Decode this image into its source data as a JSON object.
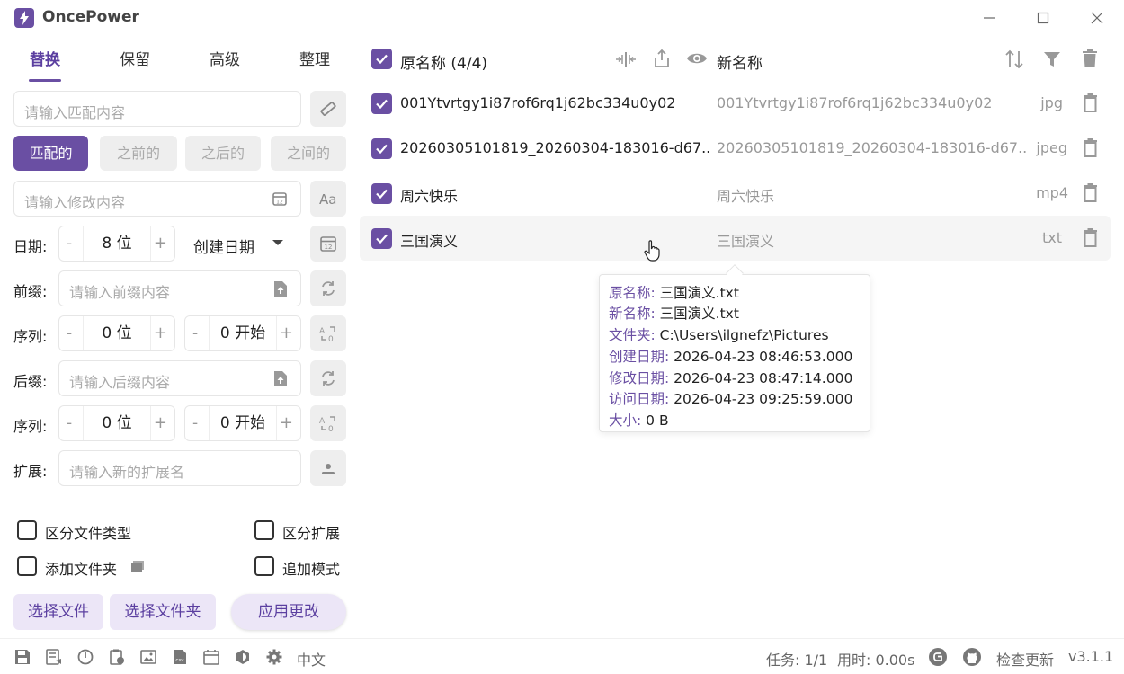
{
  "app": {
    "title": "OncePower",
    "version": "v3.1.1"
  },
  "tabs": [
    "替换",
    "保留",
    "高级",
    "整理"
  ],
  "replace": {
    "match_placeholder": "请输入匹配内容",
    "modes": [
      "匹配的",
      "之前的",
      "之后的",
      "之间的"
    ],
    "modify_placeholder": "请输入修改内容"
  },
  "date": {
    "label": "日期:",
    "digits": "8 位",
    "type": "创建日期"
  },
  "prefix": {
    "label": "前缀:",
    "placeholder": "请输入前缀内容"
  },
  "seq1": {
    "label": "序列:",
    "digits": "0 位",
    "start": "0 开始"
  },
  "suffix": {
    "label": "后缀:",
    "placeholder": "请输入后缀内容"
  },
  "seq2": {
    "label": "序列:",
    "digits": "0 位",
    "start": "0 开始"
  },
  "ext": {
    "label": "扩展:",
    "placeholder": "请输入新的扩展名"
  },
  "options": {
    "by_filetype": "区分文件类型",
    "by_ext": "区分扩展",
    "add_folder": "添加文件夹",
    "append_mode": "追加模式"
  },
  "buttons": {
    "select_files": "选择文件",
    "select_folder": "选择文件夹",
    "apply": "应用更改"
  },
  "status": {
    "lang": "中文",
    "tasks": "任务: 1/1",
    "time": "用时: 0.00s",
    "check_update": "检查更新"
  },
  "list": {
    "header_orig": "原名称 (4/4)",
    "header_new": "新名称",
    "rows": [
      {
        "orig": "001Ytvrtgy1i87rof6rq1j62bc334u0y02",
        "new": "001Ytvrtgy1i87rof6rq1j62bc334u0y02",
        "ext": "jpg"
      },
      {
        "orig": "20260305101819_20260304-183016-d67...",
        "new": "20260305101819_20260304-183016-d67...",
        "ext": "jpeg"
      },
      {
        "orig": "周六快乐",
        "new": "周六快乐",
        "ext": "mp4"
      },
      {
        "orig": "三国演义",
        "new": "三国演义",
        "ext": "txt"
      }
    ]
  },
  "tooltip": [
    {
      "key": "原名称:",
      "val": "三国演义.txt"
    },
    {
      "key": "新名称:",
      "val": "三国演义.txt"
    },
    {
      "key": "文件夹:",
      "val": "C:\\Users\\ilgnefz\\Pictures"
    },
    {
      "key": "创建日期:",
      "val": "2026-04-23 08:46:53.000"
    },
    {
      "key": "修改日期:",
      "val": "2026-04-23 08:47:14.000"
    },
    {
      "key": "访问日期:",
      "val": "2026-04-23 09:25:59.000"
    },
    {
      "key": "大小:",
      "val": "0 B"
    }
  ],
  "colors": {
    "accent": "#6a4fa3",
    "accent_light": "#ece6f7"
  }
}
